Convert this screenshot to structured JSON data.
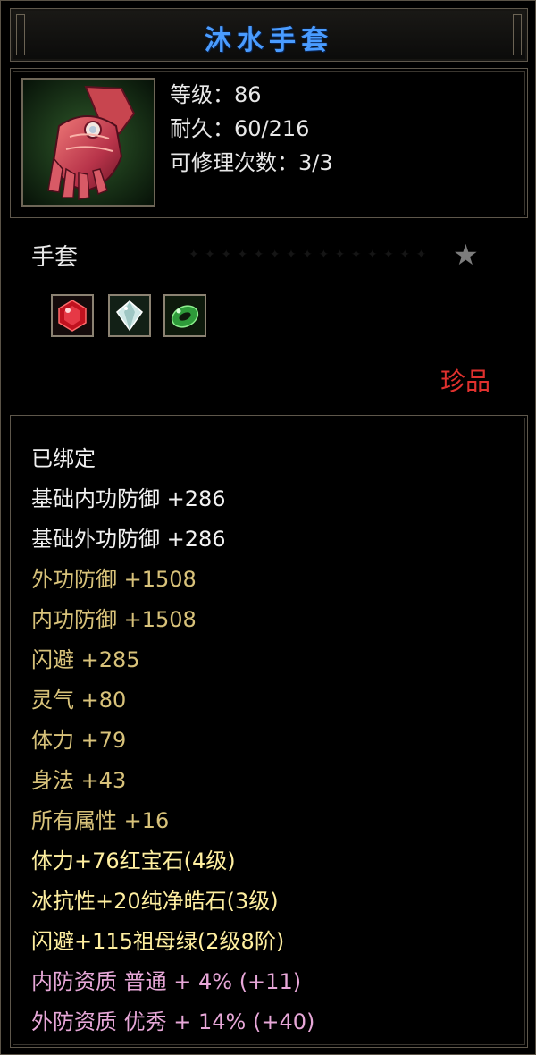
{
  "title": "沐水手套",
  "stats": [
    "等级：86",
    "耐久：60/216",
    "可修理次数：3/3"
  ],
  "item_type": "手套",
  "rarity": "珍品",
  "icons": {
    "item": "glove-icon",
    "star": "star-icon",
    "gems": [
      "ruby-gem-icon",
      "diamond-gem-icon",
      "emerald-gem-icon"
    ]
  },
  "colors": {
    "title": "#4a9cff",
    "white_attr": "#f2f2f2",
    "gold_attr": "#d8c27a",
    "gem_attr": "#ffefa0",
    "quality_attr": "#e7a7d8",
    "rarity": "#e0312e"
  },
  "attributes": [
    {
      "text": "已绑定",
      "style": "white"
    },
    {
      "text": "基础内功防御 +286",
      "style": "white"
    },
    {
      "text": "基础外功防御 +286",
      "style": "white"
    },
    {
      "text": "外功防御 +1508",
      "style": "gold"
    },
    {
      "text": "内功防御 +1508",
      "style": "gold"
    },
    {
      "text": "闪避 +285",
      "style": "gold"
    },
    {
      "text": "灵气 +80",
      "style": "gold"
    },
    {
      "text": "体力 +79",
      "style": "gold"
    },
    {
      "text": "身法 +43",
      "style": "gold"
    },
    {
      "text": "所有属性 +16",
      "style": "gold"
    },
    {
      "text": "体力+76红宝石(4级)",
      "style": "gem"
    },
    {
      "text": "冰抗性+20纯净皓石(3级)",
      "style": "gem"
    },
    {
      "text": "闪避+115祖母绿(2级8阶)",
      "style": "gem"
    },
    {
      "text": "内防资质 普通 + 4% (+11)",
      "style": "pink"
    },
    {
      "text": "外防资质 优秀 + 14% (+40)",
      "style": "pink"
    }
  ]
}
